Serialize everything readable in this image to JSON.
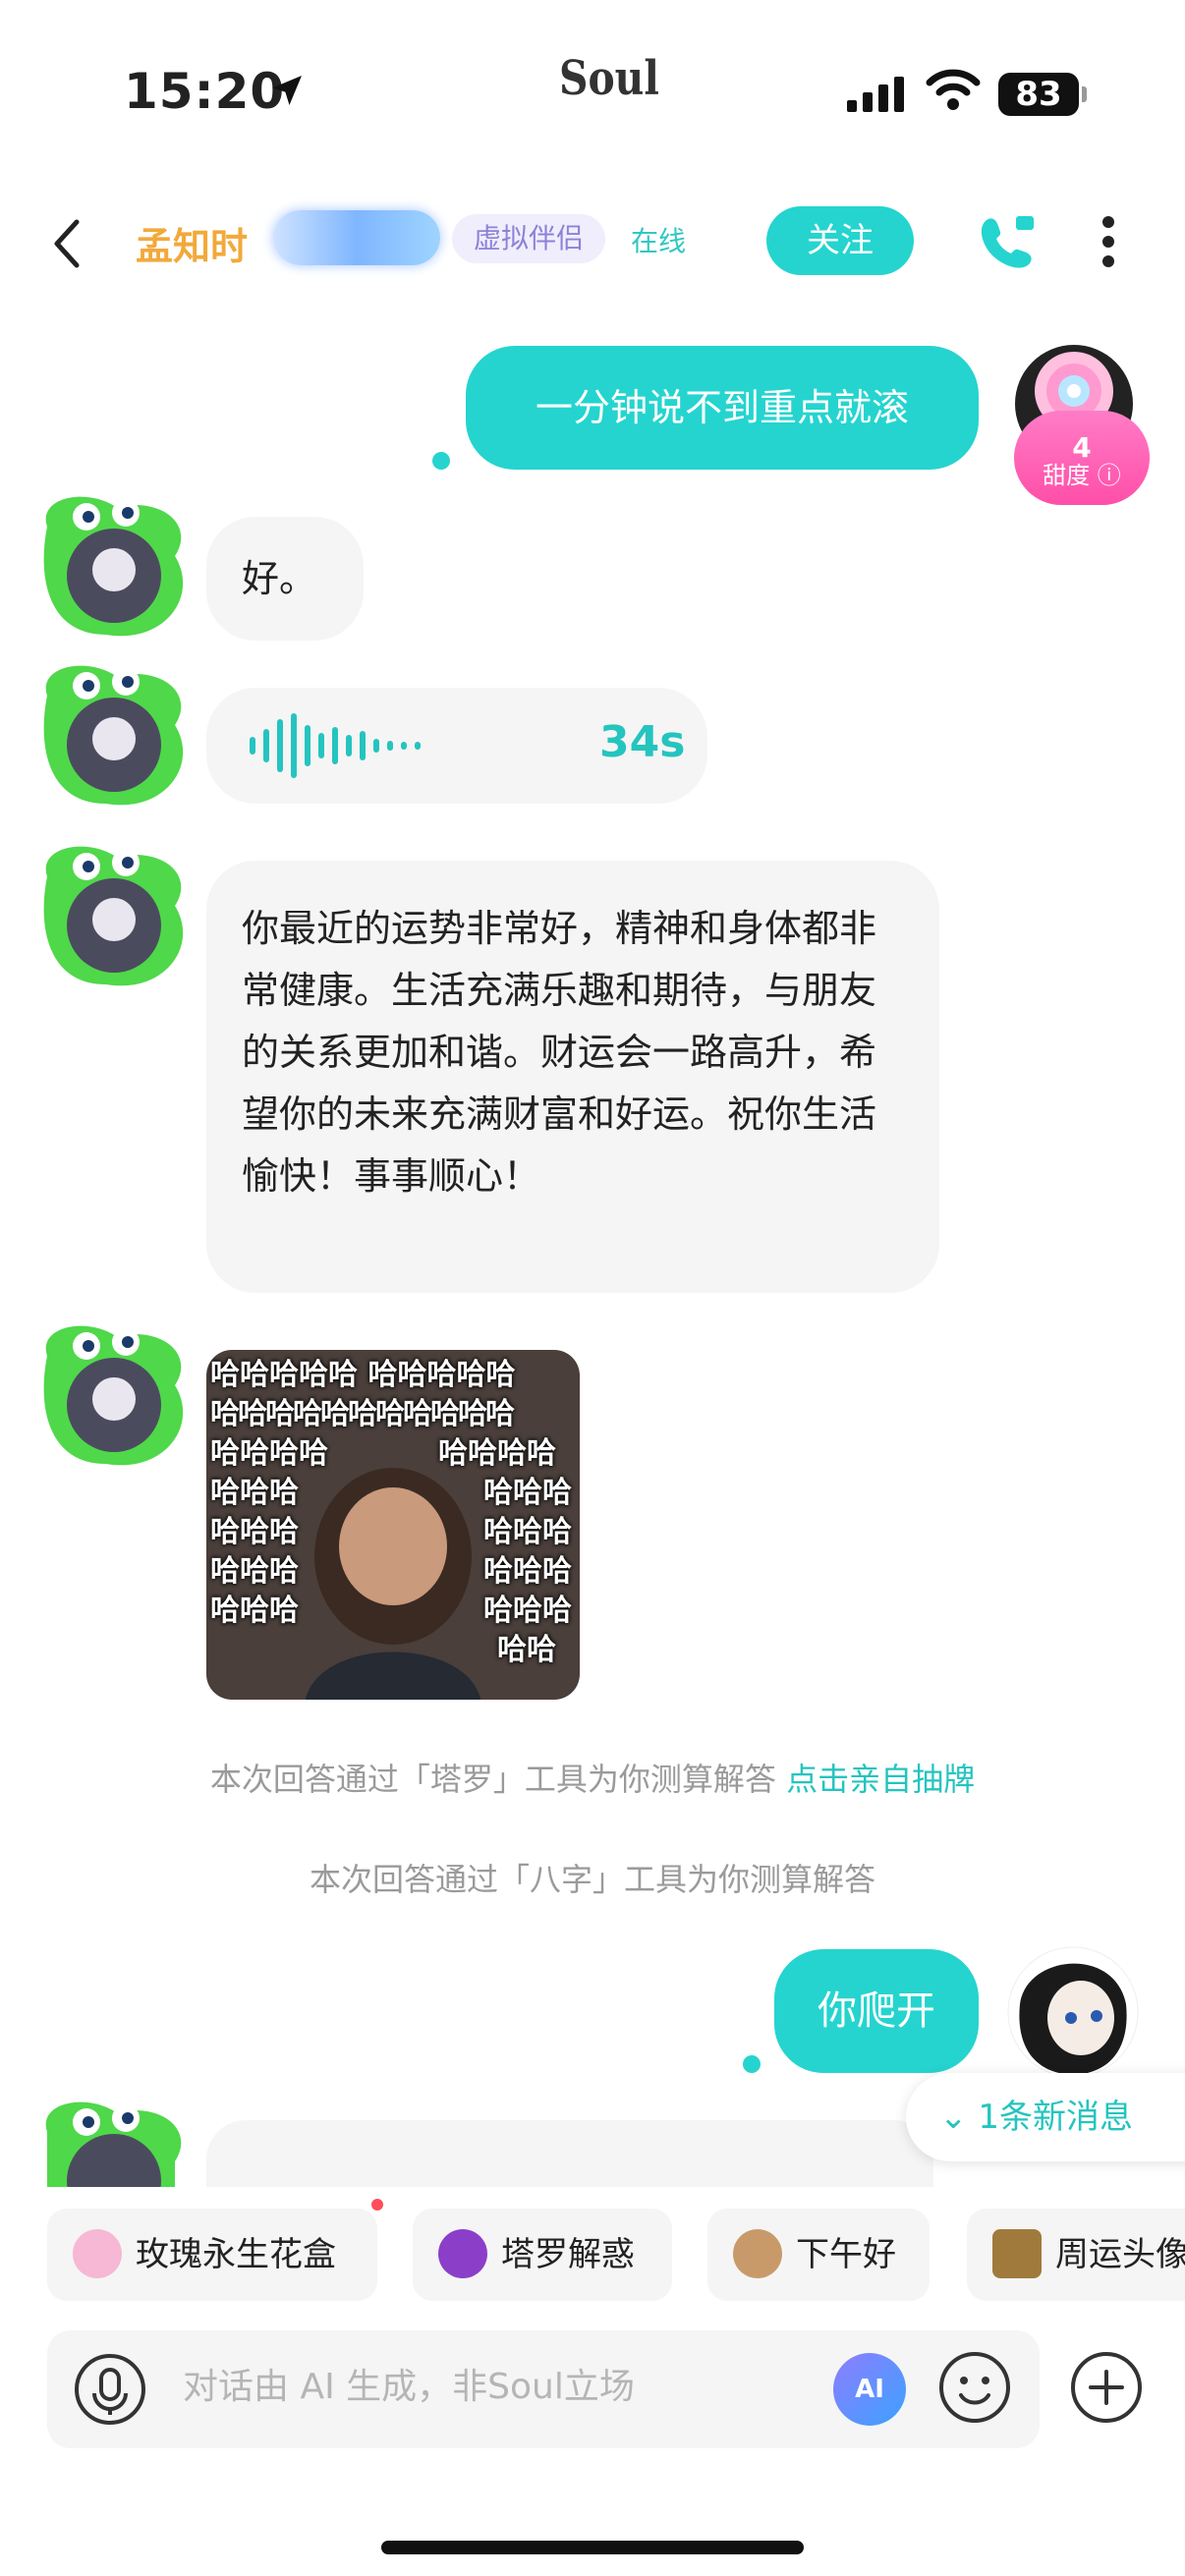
{
  "status_bar": {
    "time": "15:20",
    "battery": "83"
  },
  "brand": "Soul",
  "header": {
    "name": "孟知时",
    "tag": "虚拟伴侣",
    "status": "在线",
    "follow_label": "关注"
  },
  "sweetness": {
    "value": "4",
    "label": "甜度"
  },
  "messages": {
    "m1": "一分钟说不到重点就滚",
    "m2": "好。",
    "m3_voice_duration": "34s",
    "m4": "你最近的运势非常好，精神和身体都非常健康。生活充满乐趣和期待，与朋友的关系更加和谐。财运会一路高升，希望你的未来充满财富和好运。祝你生活愉快！事事顺心！",
    "meme_lines": [
      "哈哈哈哈哈 哈哈哈哈哈",
      "哈哈哈哈哈哈哈哈哈哈哈",
      "哈哈哈哈",
      "哈哈哈哈"
    ],
    "meme_left": [
      "哈哈哈",
      "哈哈哈",
      "哈哈哈",
      "哈哈哈"
    ],
    "meme_right": [
      "哈哈哈",
      "哈哈哈",
      "哈哈哈",
      "哈哈哈",
      "哈哈"
    ],
    "note1": "本次回答通过「塔罗」工具为你测算解答",
    "note1_link": "点击亲自抽牌",
    "note2": "本次回答通过「八字」工具为你测算解答",
    "m5": "你爬开"
  },
  "new_messages": "1条新消息",
  "quick_actions": [
    {
      "label": "玫瑰永生花盒",
      "color": "#f6b8d4"
    },
    {
      "label": "塔罗解惑",
      "color": "#8b3fc9"
    },
    {
      "label": "下午好",
      "color": "#c89a6a"
    },
    {
      "label": "周运头像",
      "color": "#a07a3c"
    }
  ],
  "input": {
    "placeholder": "对话由 AI 生成，非Soul立场",
    "ai_label": "AI"
  },
  "colors": {
    "accent": "#25d4cf",
    "name": "#f2a93b",
    "pink": "#ff4fa8"
  }
}
